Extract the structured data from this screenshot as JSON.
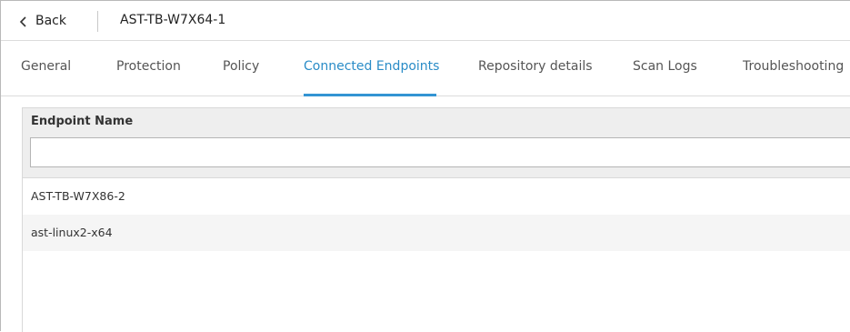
{
  "header": {
    "back_label": "Back",
    "title": "AST-TB-W7X64-1"
  },
  "tabs": [
    {
      "label": "General",
      "active": false
    },
    {
      "label": "Protection",
      "active": false
    },
    {
      "label": "Policy",
      "active": false
    },
    {
      "label": "Connected Endpoints",
      "active": true
    },
    {
      "label": "Repository details",
      "active": false
    },
    {
      "label": "Scan Logs",
      "active": false
    },
    {
      "label": "Troubleshooting",
      "active": false
    }
  ],
  "table": {
    "column_header": "Endpoint Name",
    "filter_value": "",
    "rows": [
      {
        "name": "AST-TB-W7X86-2"
      },
      {
        "name": "ast-linux2-x64"
      }
    ]
  },
  "colors": {
    "accent": "#2a8cc7",
    "header_bg": "#eeeeee",
    "alt_row_bg": "#f5f5f5"
  }
}
